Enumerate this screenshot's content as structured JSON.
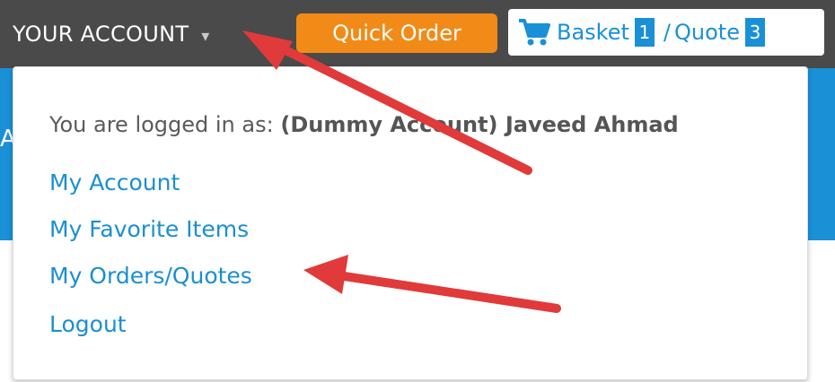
{
  "header": {
    "account_label": "YOUR ACCOUNT",
    "account_caret": "▾",
    "quick_order_label": "Quick Order",
    "basket_label": "Basket",
    "basket_count": "1",
    "separator": "/",
    "quote_label": "Quote",
    "quote_count": "3"
  },
  "background": {
    "fragment": "A"
  },
  "dropdown": {
    "logged_in_prefix": "You are logged in as:",
    "user_name": "(Dummy Account) Javeed Ahmad",
    "links": [
      {
        "label": "My Account"
      },
      {
        "label": "My Favorite Items"
      },
      {
        "label": "My Orders/Quotes"
      },
      {
        "label": "Logout"
      }
    ]
  },
  "colors": {
    "topbar": "#4a4a4a",
    "accent_blue": "#1a90d6",
    "quick_order_orange": "#f28a17",
    "annotation_red": "#e03a3a"
  },
  "icons": {
    "cart": "shopping-cart-icon",
    "caret": "chevron-down-icon"
  }
}
